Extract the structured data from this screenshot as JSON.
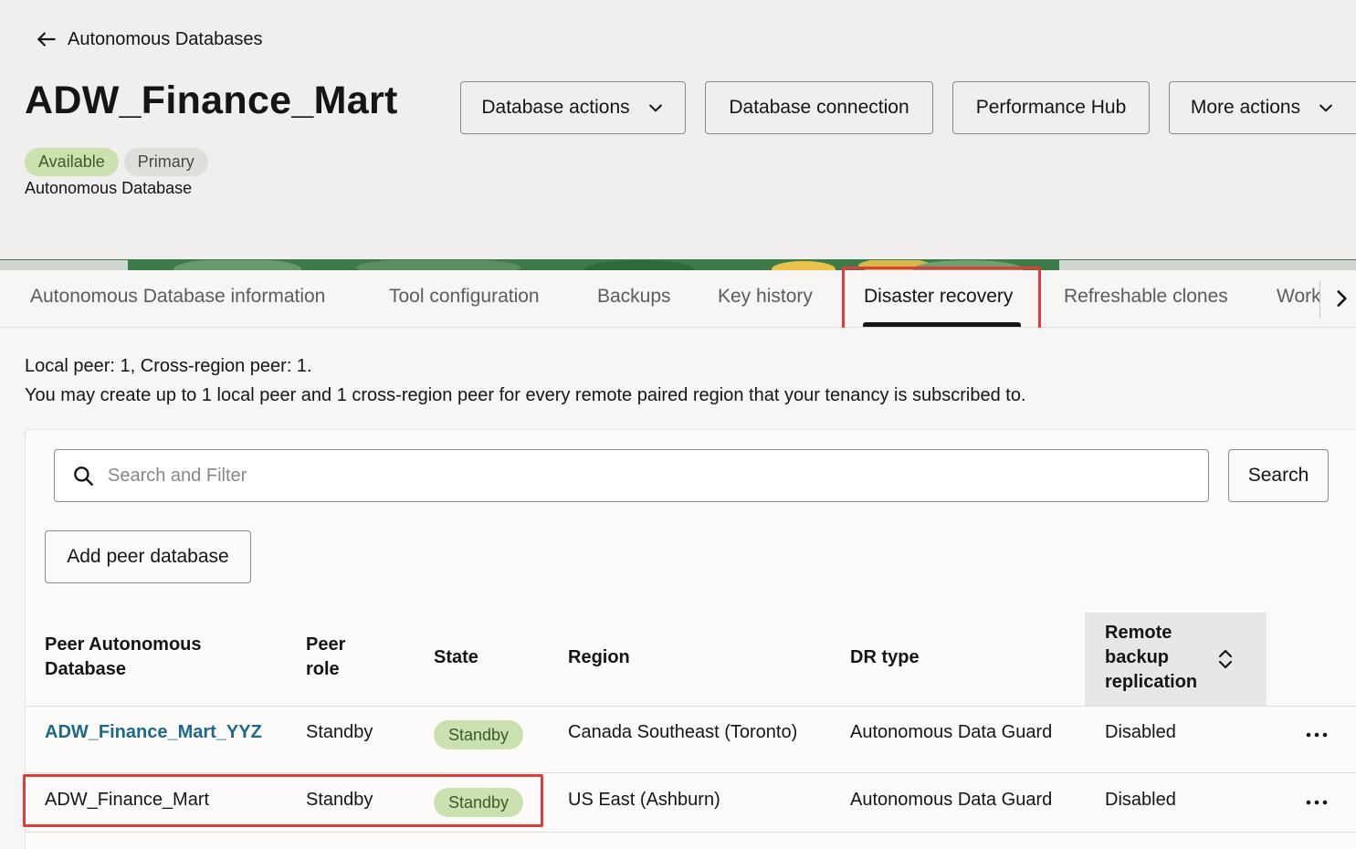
{
  "header": {
    "back_label": "Autonomous Databases",
    "title": "ADW_Finance_Mart",
    "badges": {
      "status": "Available",
      "role": "Primary"
    },
    "resource_type": "Autonomous Database",
    "actions": {
      "database_actions": "Database actions",
      "database_connection": "Database connection",
      "performance_hub": "Performance Hub",
      "more_actions": "More actions"
    }
  },
  "tabs": {
    "items": [
      {
        "label": "Autonomous Database information"
      },
      {
        "label": "Tool configuration"
      },
      {
        "label": "Backups"
      },
      {
        "label": "Key history"
      },
      {
        "label": "Disaster recovery",
        "active": true
      },
      {
        "label": "Refreshable clones"
      },
      {
        "label": "Work"
      }
    ]
  },
  "peers_info": {
    "counts": "Local peer: 1, Cross-region peer: 1.",
    "limit_note": "You may create up to 1 local peer and 1 cross-region peer for every remote paired region that your tenancy is subscribed to."
  },
  "search": {
    "placeholder": "Search and Filter",
    "button_label": "Search"
  },
  "add_peer_label": "Add peer database",
  "table": {
    "headers": {
      "peer_db": [
        "Peer Autonomous",
        "Database"
      ],
      "peer_role": [
        "Peer",
        "role"
      ],
      "state": "State",
      "region": "Region",
      "dr_type": "DR type",
      "remote_backup": [
        "Remote",
        "backup",
        "replication"
      ]
    },
    "rows": [
      {
        "name": "ADW_Finance_Mart_YYZ",
        "role": "Standby",
        "state": "Standby",
        "region": "Canada Southeast (Toronto)",
        "dr_type": "Autonomous Data Guard",
        "remote_backup": "Disabled"
      },
      {
        "name": "ADW_Finance_Mart",
        "role": "Standby",
        "state": "Standby",
        "region": "US East (Ashburn)",
        "dr_type": "Autonomous Data Guard",
        "remote_backup": "Disabled"
      }
    ]
  },
  "colors": {
    "highlight": "#e03c3c",
    "link": "#1b6a88",
    "badge_green_bg": "#cbe2b0",
    "header_bg": "#f1efed"
  },
  "icons": {
    "back": "arrow-left-icon",
    "dropdown": "chevron-down-icon",
    "tab_scroll": "chevron-right-icon",
    "search": "search-icon",
    "sort": "sort-icon",
    "row_menu": "more-horizontal-icon"
  }
}
